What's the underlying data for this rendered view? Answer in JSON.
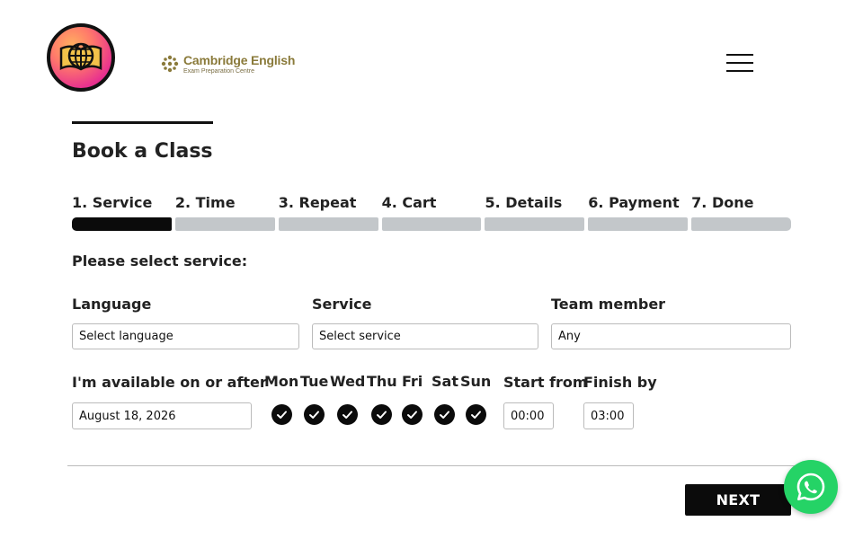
{
  "header": {
    "brand_logo_icon": "globe-book-icon",
    "partner_logo_name": "Cambridge English",
    "partner_logo_sub": "Exam Preparation Centre",
    "menu_icon": "hamburger-menu-icon"
  },
  "page": {
    "title": "Book a Class"
  },
  "steps": [
    {
      "label": "1. Service",
      "active": true
    },
    {
      "label": "2. Time",
      "active": false
    },
    {
      "label": "3. Repeat",
      "active": false
    },
    {
      "label": "4. Cart",
      "active": false
    },
    {
      "label": "5. Details",
      "active": false
    },
    {
      "label": "6. Payment",
      "active": false
    },
    {
      "label": "7. Done",
      "active": false
    }
  ],
  "form": {
    "prompt": "Please select service:",
    "language": {
      "label": "Language",
      "value": "Select language"
    },
    "service": {
      "label": "Service",
      "value": "Select service"
    },
    "team_member": {
      "label": "Team member",
      "value": "Any"
    },
    "available": {
      "label": "I'm available on or after",
      "value": "August 18, 2026"
    },
    "days": [
      {
        "label": "Mon",
        "checked": true
      },
      {
        "label": "Tue",
        "checked": true
      },
      {
        "label": "Wed",
        "checked": true
      },
      {
        "label": "Thu",
        "checked": true
      },
      {
        "label": "Fri",
        "checked": true
      },
      {
        "label": "Sat",
        "checked": true
      },
      {
        "label": "Sun",
        "checked": true
      }
    ],
    "start_from": {
      "label": "Start from",
      "value": "00:00"
    },
    "finish_by": {
      "label": "Finish by",
      "value": "03:00"
    }
  },
  "actions": {
    "next_label": "NEXT",
    "chat_icon": "whatsapp-icon"
  },
  "colors": {
    "accent": "#0b0b0b",
    "step_inactive": "#c3c7ca",
    "whatsapp": "#25d366",
    "partner_gold": "#8a7a3a"
  }
}
